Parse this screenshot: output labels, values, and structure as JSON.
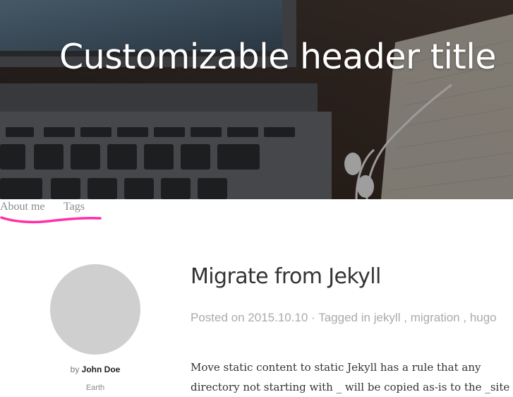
{
  "header": {
    "title": "Customizable header title",
    "image_icon": "laptop-keyboard-earphones-photo"
  },
  "nav": {
    "items": [
      {
        "label": "About me"
      },
      {
        "label": "Tags"
      }
    ],
    "highlight_color": "#ff2fa8"
  },
  "sidebar": {
    "by_prefix": "by",
    "author_name": "John Doe",
    "location": "Earth",
    "avatar_color": "#cfcfcf"
  },
  "post": {
    "title": "Migrate from Jekyll",
    "posted_prefix": "Posted on",
    "date": "2015.10.10",
    "separator": "·",
    "tagged_prefix": "Tagged in",
    "tags": [
      "jekyll",
      "migration",
      "hugo"
    ],
    "tag_separator": ",",
    "excerpt": "Move static content to static Jekyll has a rule that any directory not starting with _ will be copied as-is to the _site"
  }
}
